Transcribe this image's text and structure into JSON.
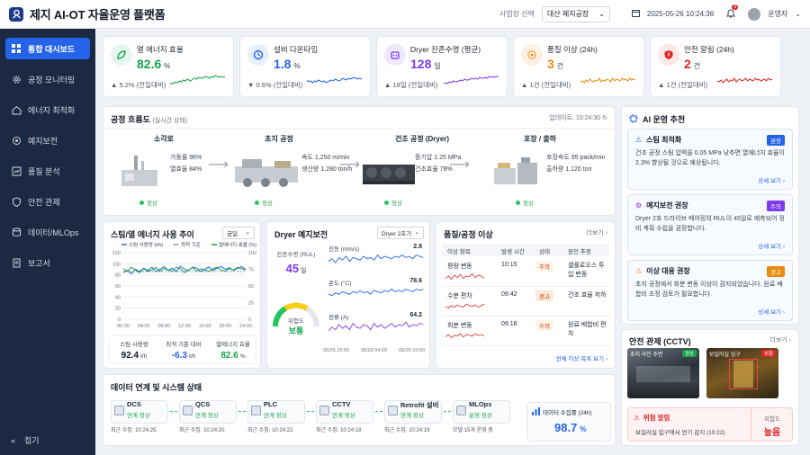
{
  "header": {
    "title": "제지 AI-OT 자율운영 플랫폼",
    "site_label": "사업장 선택",
    "site_value": "대산 제지공장",
    "datetime": "2025-05-26 10:24:36",
    "notif_count": "3",
    "user": "운영자"
  },
  "sidebar": {
    "items": [
      {
        "label": "통합 대시보드"
      },
      {
        "label": "공정 모니터링"
      },
      {
        "label": "에너지 최적화"
      },
      {
        "label": "예지보전"
      },
      {
        "label": "품질 분석"
      },
      {
        "label": "안전 관제"
      },
      {
        "label": "데이터/MLOps"
      },
      {
        "label": "보고서"
      }
    ],
    "collapse": "접기"
  },
  "kpis": [
    {
      "title": "열 에너지 효율",
      "value": "82.6",
      "unit": "%",
      "delta": "▲ 5.2% (전일대비)",
      "color": "#16a34a",
      "bg": "#e7f6ec"
    },
    {
      "title": "설비 다운타임",
      "value": "1.8",
      "unit": "%",
      "delta": "▼ 0.6% (전일대비)",
      "color": "#2563eb",
      "bg": "#e6effd"
    },
    {
      "title": "Dryer 잔존수명 (평균)",
      "value": "128",
      "unit": "일",
      "delta": "▲ 18일 (전일대비)",
      "color": "#7c3aed",
      "bg": "#efe9fd"
    },
    {
      "title": "품질 이상 (24h)",
      "value": "3",
      "unit": "건",
      "delta": "▲ 1건 (전일대비)",
      "color": "#ea8a0c",
      "bg": "#fdf1e1"
    },
    {
      "title": "안전 알림 (24h)",
      "value": "2",
      "unit": "건",
      "delta": "▲ 1건 (전일대비)",
      "color": "#dc2626",
      "bg": "#fde8e8"
    }
  ],
  "flow": {
    "title": "공정 흐름도",
    "subtitle": "(실시간 상태)",
    "updated": "업데이트: 10:24:30",
    "stages": [
      {
        "name": "소각로",
        "l1": "가동률 96%",
        "l2": "열효율 84%",
        "status": "정상"
      },
      {
        "name": "초지 공정",
        "l1": "속도 1,250 m/min",
        "l2": "생산량 1,280 ton/h",
        "status": "정상"
      },
      {
        "name": "건조 공정 (Dryer)",
        "l1": "증기압 1.25 MPa",
        "l2": "건조효율 78%",
        "status": "정상"
      },
      {
        "name": "포장 / 출하",
        "l1": "포장속도 95 pack/min",
        "l2": "출하량 1,120 ton",
        "status": "정상"
      }
    ]
  },
  "ai": {
    "title": "AI 운영 추천",
    "items": [
      {
        "title": "스팀 최적화",
        "tag": "권장",
        "tag_color": "#2563eb",
        "body": "건조 공정 스팀 압력을 0.05 MPa 낮추면 열에너지 효율이 2.3% 향상될 것으로 예상됩니다.",
        "link": "상세 보기 ›"
      },
      {
        "title": "예지보전 권장",
        "tag": "주의",
        "tag_color": "#7c3aed",
        "body": "Dryer 2호 드라이브 베어링의 RUL이 45일로 예측되어 정비 계획 수립을 권장합니다.",
        "link": "상세 보기 ›"
      },
      {
        "title": "이상 대응 권장",
        "tag": "경고",
        "tag_color": "#ea8a0c",
        "body": "초지 공정에서 회분 변동 이상이 감지되었습니다. 원료 배합비 조정 검토가 필요합니다.",
        "link": "상세 보기 ›"
      }
    ]
  },
  "energy": {
    "title": "스팀/열 에너지 사용 추이",
    "range": "금일",
    "legend": [
      "스팀 사용량 (t/h)",
      "최적 기준",
      "열에너지 효율 (%)"
    ],
    "y_left": [
      "120",
      "100",
      "80",
      "60",
      "40",
      "20",
      "0"
    ],
    "y_right": [
      "100",
      "75",
      "50",
      "25",
      "0"
    ],
    "x": [
      "00:00",
      "04:00",
      "08:00",
      "12:00",
      "16:00",
      "20:00",
      "24:00"
    ],
    "stats": [
      {
        "label": "스팀 사용량",
        "value": "92.4",
        "unit": "t/h"
      },
      {
        "label": "최적 기준 대비",
        "value": "-6.3",
        "unit": "t/h"
      },
      {
        "label": "열에너지 효율",
        "value": "82.6",
        "unit": "%"
      }
    ]
  },
  "dryer": {
    "title": "Dryer 예지보전",
    "unit_sel": "Dryer 2호기",
    "rul_label": "잔존수명 (RUL)",
    "rul_value": "45",
    "rul_unit": "일",
    "risk_label": "위험도",
    "risk_value": "보통",
    "signals": [
      {
        "name": "진동 (mm/s)",
        "value": "2.8"
      },
      {
        "name": "온도 (°C)",
        "value": "78.6"
      },
      {
        "name": "전류 (A)",
        "value": "64.2"
      }
    ],
    "x": [
      "05/25 22:00",
      "05/26 04:00",
      "05/26 10:00"
    ]
  },
  "quality": {
    "title": "품질/공정 이상",
    "more": "더보기 ›",
    "cols": [
      "이상 항목",
      "발생 시간",
      "상태",
      "원인 추정"
    ],
    "rows": [
      {
        "item": "평량 변동",
        "time": "10:15",
        "state": "주의",
        "cause": "셀룰로오스 투입 변동"
      },
      {
        "item": "수분 편차",
        "time": "09:42",
        "state": "경고",
        "cause": "건조 효율 저하"
      },
      {
        "item": "회분 변동",
        "time": "09:18",
        "state": "주의",
        "cause": "원료 배합비 편차"
      }
    ],
    "all_link": "전체 이상 목록 보기 ›"
  },
  "systems": {
    "title": "데이터 연계 및 시스템 상태",
    "items": [
      {
        "name": "DCS",
        "status": "연계 정상",
        "time": "최근 수집: 10:24:25"
      },
      {
        "name": "QCS",
        "status": "연계 정상",
        "time": "최근 수집: 10:24:20"
      },
      {
        "name": "PLC",
        "status": "연계 정상",
        "time": "최근 수집: 10:24:22"
      },
      {
        "name": "CCTV",
        "status": "연계 정상",
        "time": "최근 수집: 10:24:18"
      },
      {
        "name": "Retrofit 설비",
        "status": "연계 정상",
        "time": "최근 수집: 10:24:19"
      },
      {
        "name": "MLOps",
        "status": "운영 정상",
        "time": "모델 15개 운영 중"
      }
    ],
    "rate_label": "데이터 수집률 (24h)",
    "rate_value": "98.7",
    "rate_unit": "%"
  },
  "cctv": {
    "title": "안전 관제 (CCTV)",
    "more": "더보기 ›",
    "cams": [
      {
        "name": "초지 라인 주변",
        "state": "정상"
      },
      {
        "name": "보일러실 입구",
        "state": "위험"
      }
    ],
    "alert_title": "위험 알림",
    "alert_body": "보일러실 입구에서 연기 감지 (10:22)",
    "alert_level_label": "위험도",
    "alert_level": "높음"
  }
}
